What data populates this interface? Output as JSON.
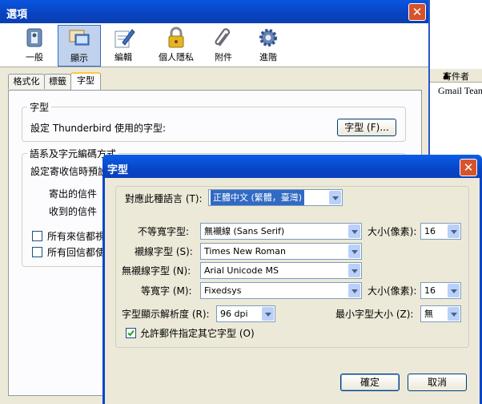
{
  "background_window": {
    "column_header": "寄件者",
    "row_sender": "Gmail Team"
  },
  "options_dialog": {
    "title": "選項",
    "close_glyph": "✕",
    "toolbar": [
      {
        "label": "一般",
        "icon": "general-switch-icon"
      },
      {
        "label": "顯示",
        "icon": "display-monitor-icon"
      },
      {
        "label": "編輯",
        "icon": "edit-pen-icon"
      },
      {
        "label": "個人隱私",
        "icon": "privacy-lock-icon"
      },
      {
        "label": "附件",
        "icon": "attachment-clip-icon"
      },
      {
        "label": "進階",
        "icon": "advanced-gear-icon"
      }
    ],
    "tabs": [
      "格式化",
      "標籤",
      "字型"
    ],
    "fonts_group": {
      "title": "字型",
      "description": "設定 Thunderbird 使用的字型:",
      "button": "字型 (F)..."
    },
    "lang_group": {
      "title": "語系及字元編碼方式",
      "description": "設定寄收信時預設",
      "outgoing": "寄出的信件",
      "incoming": "收到的信件",
      "check1": "所有來信都視",
      "check2": "所有回信都使"
    }
  },
  "fonts_dialog": {
    "title": "字型",
    "close_glyph": "✕",
    "language_label": "對應此種語言 (T):",
    "language_value": "正體中文 (繁體，臺灣)",
    "proportional_label": "不等寬字型:",
    "proportional_value": "無襯線 (Sans Serif)",
    "serif_label": "襯線字型 (S):",
    "serif_value": "Times New Roman",
    "sans_label": "無襯線字型 (N):",
    "sans_value": "Arial Unicode MS",
    "mono_label": "等寬字 (M):",
    "mono_value": "Fixedsys",
    "size_label": "大小(像素):",
    "size_value1": "16",
    "size_value2": "16",
    "resolution_label": "字型顯示解析度 (R):",
    "resolution_value": "96 dpi",
    "min_size_label": "最小字型大小 (Z):",
    "min_size_value": "無",
    "allow_label": "允許郵件指定其它字型 (O)",
    "allow_checked": true,
    "ok": "確定",
    "cancel": "取消"
  }
}
